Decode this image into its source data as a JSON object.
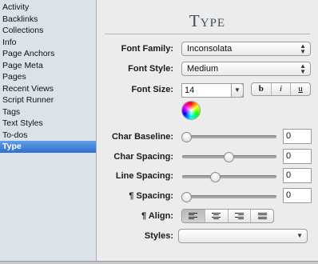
{
  "sidebar": {
    "items": [
      {
        "label": "Activity"
      },
      {
        "label": "Backlinks"
      },
      {
        "label": "Collections"
      },
      {
        "label": "Info"
      },
      {
        "label": "Page Anchors"
      },
      {
        "label": "Page Meta"
      },
      {
        "label": "Pages"
      },
      {
        "label": "Recent Views"
      },
      {
        "label": "Script Runner"
      },
      {
        "label": "Tags"
      },
      {
        "label": "Text Styles"
      },
      {
        "label": "To-dos"
      },
      {
        "label": "Type"
      }
    ],
    "selected": "Type"
  },
  "panel": {
    "title": "Type",
    "font_family": {
      "label": "Font Family:",
      "value": "Inconsolata"
    },
    "font_style": {
      "label": "Font Style:",
      "value": "Medium"
    },
    "font_size": {
      "label": "Font Size:",
      "value": "14"
    },
    "style_buttons": {
      "bold": "b",
      "italic": "i",
      "underline": "u"
    },
    "char_baseline": {
      "label": "Char Baseline:",
      "value": "0",
      "level": 0.0
    },
    "char_spacing": {
      "label": "Char Spacing:",
      "value": "0",
      "level": 0.5
    },
    "line_spacing": {
      "label": "Line Spacing:",
      "value": "0",
      "level": 0.33
    },
    "para_spacing": {
      "label": "¶ Spacing:",
      "value": "0",
      "level": 0.0
    },
    "align": {
      "label": "¶ Align:",
      "selected": "left",
      "options": [
        "left",
        "center",
        "right",
        "justify"
      ]
    },
    "styles": {
      "label": "Styles:",
      "value": ""
    }
  },
  "colors": {
    "selection": "#3b7fd9",
    "sidebar_bg": "#dce2ea",
    "panel_bg": "#ececec"
  }
}
